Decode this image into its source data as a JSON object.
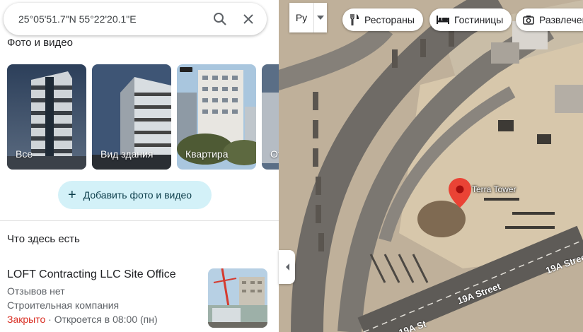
{
  "search": {
    "query": "25°05'51.7\"N 55°22'20.1\"E"
  },
  "photos_section": {
    "title": "Фото и видео",
    "items": [
      {
        "label": "Все"
      },
      {
        "label": "Вид здания"
      },
      {
        "label": "Квартира"
      },
      {
        "label": "Oт"
      }
    ],
    "add_button": "Добавить фото и видео"
  },
  "nearby": {
    "title": "Что здесь есть",
    "place": {
      "name": "LOFT Contracting LLC Site Office",
      "reviews": "Отзывов нет",
      "category": "Строительная компания",
      "status": "Закрыто",
      "hours": " · Откроется в 08:00 (пн)"
    }
  },
  "map": {
    "language_toggle": "Ру",
    "chips": [
      {
        "label": "Рестораны",
        "icon": "fork-knife-icon"
      },
      {
        "label": "Гостиницы",
        "icon": "bed-icon"
      },
      {
        "label": "Развлечения",
        "icon": "camera-icon"
      }
    ],
    "pin_label": "Terra Tower",
    "streets": [
      "19A Street",
      "19A Street",
      "19A St"
    ]
  },
  "colors": {
    "pin": "#ea4335",
    "add_button_bg": "#d3f1f8",
    "closed": "#d93025"
  }
}
